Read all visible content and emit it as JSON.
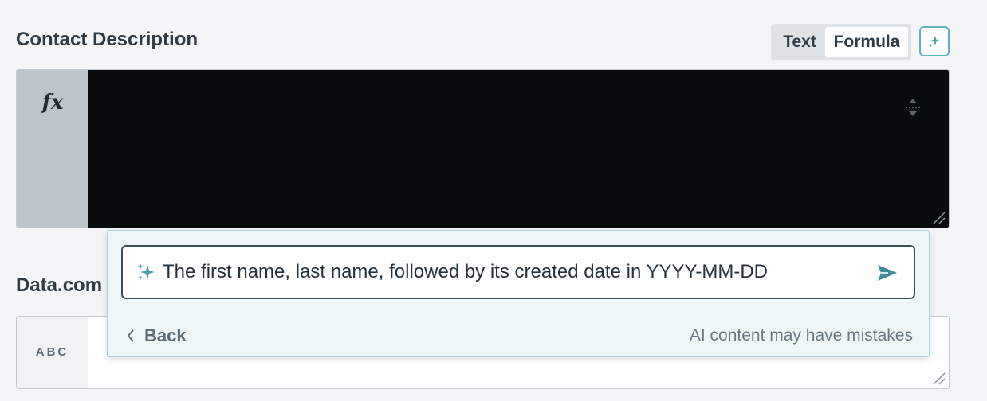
{
  "fields": {
    "contact_description": {
      "label": "Contact Description",
      "gutter_glyph": "fx",
      "mode_toggle": {
        "text_label": "Text",
        "formula_label": "Formula",
        "selected": "Formula"
      }
    },
    "datacom": {
      "label": "Data.com",
      "gutter_label": "ABC"
    }
  },
  "ai_popover": {
    "prompt_value": "The first name, last name, followed by its created date in YYYY-MM-DD",
    "back_label": "Back",
    "disclaimer": "AI content may have mistakes"
  },
  "icons": {
    "ai_toggle": "sparkle-icon",
    "prompt": "sparkle-icon",
    "send": "send-icon",
    "back": "chevron-left-icon",
    "expand": "expand-vertical-icon",
    "resize": "resize-grip-icon"
  },
  "colors": {
    "accent": "#5fb4bd",
    "editor_bg": "#090c0d",
    "popover_bg": "#eef6f7",
    "send_icon": "#3f8b98"
  }
}
